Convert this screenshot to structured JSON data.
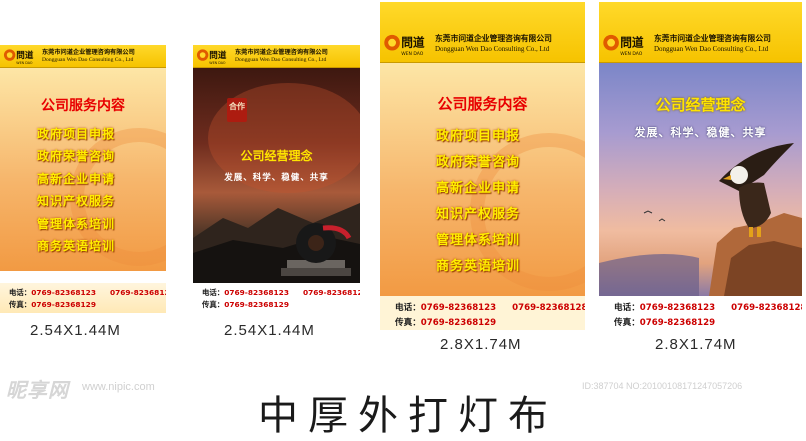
{
  "colors": {
    "header_yellow": "#f6c300",
    "service_title_red": "#e80000",
    "list_yellow": "#ffee00",
    "phone_red": "#cc0000",
    "philosophy_yellow": "#ffe400"
  },
  "company": {
    "logo_text": "問道",
    "logo_sub": "WEN DAO",
    "name_cn": "东莞市问道企业管理咨询有限公司",
    "name_en": "Dongguan Wen Dao Consulting Co., Ltd"
  },
  "service": {
    "title": "公司服务内容",
    "items": [
      {
        "label": "政府项目申报"
      },
      {
        "label": "政府荣誉咨询"
      },
      {
        "label": "高新企业申请"
      },
      {
        "label": "知识产权服务"
      },
      {
        "label": "管理体系培训"
      },
      {
        "label": "商务英语培训"
      }
    ]
  },
  "philosophy": {
    "title": "公司经营理念",
    "tagline": "发展、科学、稳健、共享",
    "seal_text": "合作"
  },
  "contact": {
    "tel_label": "电话：",
    "tel_1": "0769-82368123",
    "tel_2": "0769-82368128",
    "fax_label": "传真：",
    "fax": "0769-82368129"
  },
  "sizes": {
    "s1": "2.54X1.44M",
    "s2": "2.54X1.44M",
    "s3": "2.8X1.74M",
    "s4": "2.8X1.74M"
  },
  "page_title": "中厚外打灯布",
  "watermark": {
    "site": "昵享网",
    "url": "www.nipic.com",
    "id": "ID:387704 NO:20100108171247057206"
  }
}
